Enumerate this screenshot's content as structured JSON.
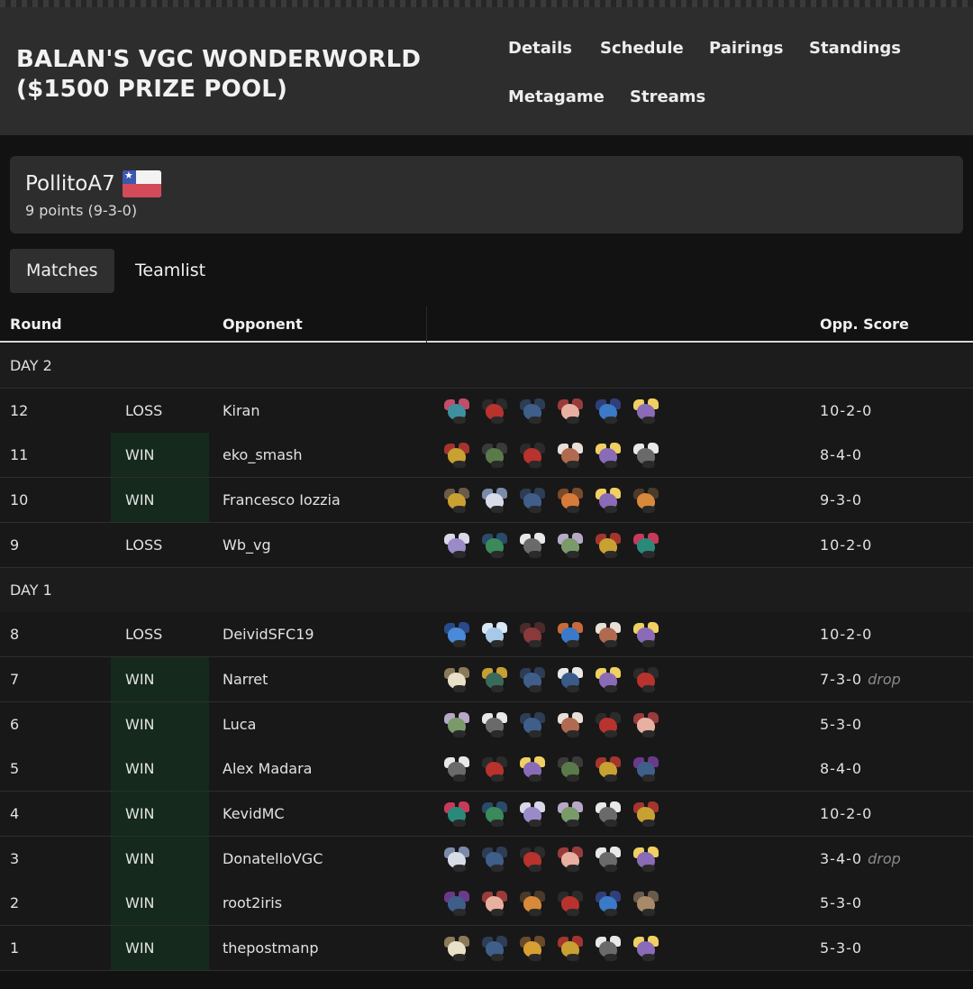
{
  "header": {
    "title": "BALAN'S VGC WONDERWORLD ($1500 PRIZE POOL)",
    "nav": [
      "Details",
      "Schedule",
      "Pairings",
      "Standings",
      "Metagame",
      "Streams"
    ]
  },
  "player": {
    "name": "PollitoA7",
    "flag": "chile-flag-icon",
    "record": "9 points (9-3-0)"
  },
  "tabs": {
    "matches": "Matches",
    "teamlist": "Teamlist"
  },
  "table": {
    "headers": {
      "round": "Round",
      "opponent": "Opponent",
      "score": "Opp. Score"
    },
    "days": [
      {
        "label": "DAY 2",
        "matches": [
          {
            "round": "12",
            "result": "LOSS",
            "opponent": "Kiran",
            "score": "10-2-0",
            "drop": "",
            "team": [
              [
                "#3f8f9f",
                "#c24d6a"
              ],
              [
                "#b8322e",
                "#2b2b2b"
              ],
              [
                "#3f5f8a",
                "#2d3d55"
              ],
              [
                "#e8b0a0",
                "#9a3b3b"
              ],
              [
                "#3a7ac8",
                "#2f3f7a"
              ],
              [
                "#8a6bb8",
                "#f0d060"
              ]
            ]
          },
          {
            "round": "11",
            "result": "WIN",
            "opponent": "eko_smash",
            "score": "8-4-0",
            "drop": "",
            "team": [
              [
                "#c9a032",
                "#a3352e"
              ],
              [
                "#5a7a4a",
                "#3a3a3a"
              ],
              [
                "#b8322e",
                "#2b2b2b"
              ],
              [
                "#b06a50",
                "#e8e0d8"
              ],
              [
                "#8a6bb8",
                "#f0d060"
              ],
              [
                "#6a6a6a",
                "#e8e8e8"
              ]
            ]
          },
          {
            "round": "10",
            "result": "WIN",
            "opponent": "Francesco Iozzia",
            "score": "9-3-0",
            "drop": "",
            "team": [
              [
                "#c9a032",
                "#6a5a4a"
              ],
              [
                "#d8dce8",
                "#7a8aa8"
              ],
              [
                "#3f5f8a",
                "#2d3d55"
              ],
              [
                "#d87a3a",
                "#7a4a2a"
              ],
              [
                "#8a6bb8",
                "#f0d060"
              ],
              [
                "#d88a3a",
                "#4a3a2a"
              ]
            ]
          },
          {
            "round": "9",
            "result": "LOSS",
            "opponent": "Wb_vg",
            "score": "10-2-0",
            "drop": "",
            "team": [
              [
                "#9a8ac8",
                "#d8d8e8"
              ],
              [
                "#3a8a5a",
                "#2a4a6a"
              ],
              [
                "#6a6a6a",
                "#e8e8e8"
              ],
              [
                "#7a9a6a",
                "#b8a8c8"
              ],
              [
                "#c9a032",
                "#a3352e"
              ],
              [
                "#2a8a7a",
                "#c83a5a"
              ]
            ]
          }
        ]
      },
      {
        "label": "DAY 1",
        "matches": [
          {
            "round": "8",
            "result": "LOSS",
            "opponent": "DeividSFC19",
            "score": "10-2-0",
            "drop": "",
            "team": [
              [
                "#4a8ad8",
                "#2a4a8a"
              ],
              [
                "#a8c8e8",
                "#d8e8f8"
              ],
              [
                "#8a3a3a",
                "#4a2a2a"
              ],
              [
                "#3a7ac8",
                "#c86a3a"
              ],
              [
                "#b06a50",
                "#e8e0d8"
              ],
              [
                "#8a6bb8",
                "#f0d060"
              ]
            ]
          },
          {
            "round": "7",
            "result": "WIN",
            "opponent": "Narret",
            "score": "7-3-0",
            "drop": "drop",
            "team": [
              [
                "#e8e0c8",
                "#8a7a5a"
              ],
              [
                "#3a6a5a",
                "#c8a032"
              ],
              [
                "#3f5f8a",
                "#2d3d55"
              ],
              [
                "#3a5a8a",
                "#e8e8e8"
              ],
              [
                "#8a6bb8",
                "#f0d060"
              ],
              [
                "#b8322e",
                "#2b2b2b"
              ]
            ]
          },
          {
            "round": "6",
            "result": "WIN",
            "opponent": "Luca",
            "score": "5-3-0",
            "drop": "",
            "team": [
              [
                "#7a9a6a",
                "#b8a8c8"
              ],
              [
                "#6a6a6a",
                "#e8e8e8"
              ],
              [
                "#3f5f8a",
                "#2d3d55"
              ],
              [
                "#b06a50",
                "#e8e0d8"
              ],
              [
                "#b8322e",
                "#2b2b2b"
              ],
              [
                "#e8b0a0",
                "#9a3b3b"
              ]
            ]
          },
          {
            "round": "5",
            "result": "WIN",
            "opponent": "Alex Madara",
            "score": "8-4-0",
            "drop": "",
            "team": [
              [
                "#6a6a6a",
                "#e8e8e8"
              ],
              [
                "#b8322e",
                "#2b2b2b"
              ],
              [
                "#8a6bb8",
                "#f0d060"
              ],
              [
                "#5a7a4a",
                "#3a3a3a"
              ],
              [
                "#c9a032",
                "#a3352e"
              ],
              [
                "#3f5f8a",
                "#6a3a8a"
              ]
            ]
          },
          {
            "round": "4",
            "result": "WIN",
            "opponent": "KevidMC",
            "score": "10-2-0",
            "drop": "",
            "team": [
              [
                "#2a8a7a",
                "#c83a5a"
              ],
              [
                "#3a8a5a",
                "#2a4a6a"
              ],
              [
                "#9a8ac8",
                "#d8d8e8"
              ],
              [
                "#7a9a6a",
                "#b8a8c8"
              ],
              [
                "#6a6a6a",
                "#e8e8e8"
              ],
              [
                "#c9a032",
                "#a3352e"
              ]
            ]
          },
          {
            "round": "3",
            "result": "WIN",
            "opponent": "DonatelloVGC",
            "score": "3-4-0",
            "drop": "drop",
            "team": [
              [
                "#d8dce8",
                "#7a8aa8"
              ],
              [
                "#3f5f8a",
                "#2d3d55"
              ],
              [
                "#b8322e",
                "#2b2b2b"
              ],
              [
                "#e8b0a0",
                "#9a3b3b"
              ],
              [
                "#6a6a6a",
                "#e8e8e8"
              ],
              [
                "#8a6bb8",
                "#f0d060"
              ]
            ]
          },
          {
            "round": "2",
            "result": "WIN",
            "opponent": "root2iris",
            "score": "5-3-0",
            "drop": "",
            "team": [
              [
                "#3f5f8a",
                "#6a3a8a"
              ],
              [
                "#e8b0a0",
                "#9a3b3b"
              ],
              [
                "#d88a3a",
                "#4a3a2a"
              ],
              [
                "#b8322e",
                "#2b2b2b"
              ],
              [
                "#3a7ac8",
                "#2f3f7a"
              ],
              [
                "#a88a6a",
                "#6a5a4a"
              ]
            ]
          },
          {
            "round": "1",
            "result": "WIN",
            "opponent": "thepostmanp",
            "score": "5-3-0",
            "drop": "",
            "team": [
              [
                "#e8e0c8",
                "#8a7a5a"
              ],
              [
                "#3f5f8a",
                "#2d3d55"
              ],
              [
                "#d8a032",
                "#6a4a2a"
              ],
              [
                "#c9a032",
                "#a3352e"
              ],
              [
                "#6a6a6a",
                "#e8e8e8"
              ],
              [
                "#8a6bb8",
                "#f0d060"
              ]
            ]
          }
        ]
      }
    ]
  }
}
